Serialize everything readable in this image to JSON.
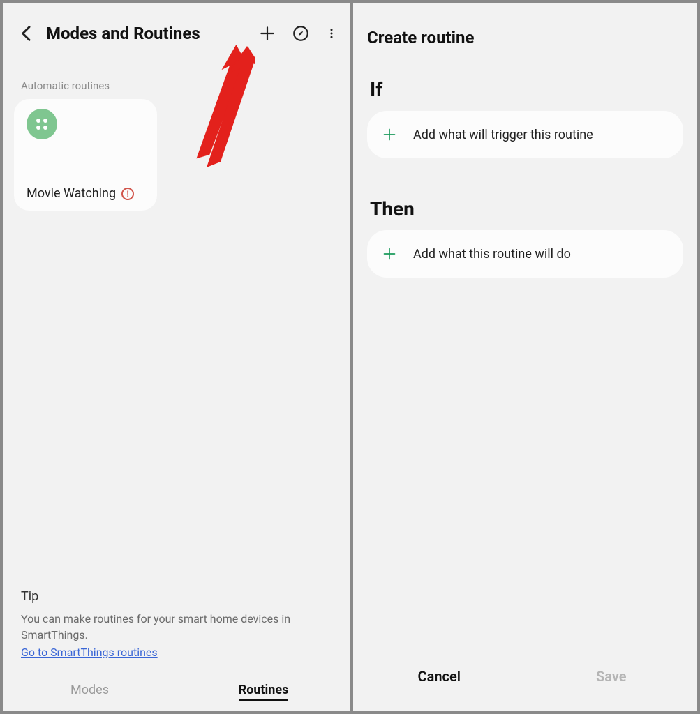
{
  "left": {
    "title": "Modes and Routines",
    "section_label": "Automatic routines",
    "routine": {
      "name": "Movie Watching"
    },
    "tip": {
      "heading": "Tip",
      "body": "You can make routines for your smart home devices in SmartThings.",
      "link": "Go to SmartThings routines"
    },
    "tabs": {
      "modes": "Modes",
      "routines": "Routines"
    }
  },
  "right": {
    "title": "Create routine",
    "if_heading": "If",
    "if_add": "Add what will trigger this routine",
    "then_heading": "Then",
    "then_add": "Add what this routine will do",
    "cancel": "Cancel",
    "save": "Save"
  }
}
